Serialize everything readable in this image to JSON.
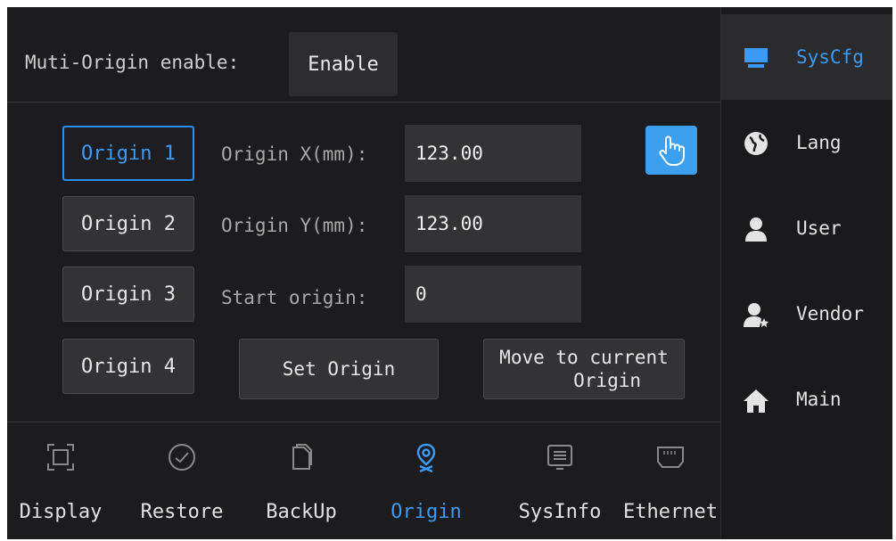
{
  "header": {
    "multi_origin_label": "Muti-Origin enable:",
    "enable_button": "Enable"
  },
  "origins": {
    "buttons": [
      "Origin 1",
      "Origin 2",
      "Origin 3",
      "Origin 4"
    ],
    "active_index": 0
  },
  "fields": {
    "x_label": "Origin X(mm):",
    "x_value": "123.00",
    "y_label": "Origin Y(mm):",
    "y_value": "123.00",
    "start_label": "Start origin:",
    "start_value": "0"
  },
  "actions": {
    "set_origin": "Set Origin",
    "move_to_current_line1": "Move to current",
    "move_to_current_line2": "Origin"
  },
  "tabs": [
    {
      "label": "Display",
      "icon": "display-icon"
    },
    {
      "label": "Restore",
      "icon": "clock-icon"
    },
    {
      "label": "BackUp",
      "icon": "copy-icon"
    },
    {
      "label": "Origin",
      "icon": "location-icon",
      "active": true
    },
    {
      "label": "SysInfo",
      "icon": "sysinfo-icon"
    },
    {
      "label": "Ethernet",
      "icon": "ethernet-icon"
    }
  ],
  "sidebar": {
    "items": [
      {
        "label": "SysCfg",
        "icon": "monitor-icon",
        "active": true
      },
      {
        "label": "Lang",
        "icon": "globe-icon"
      },
      {
        "label": "User",
        "icon": "user-icon"
      },
      {
        "label": "Vendor",
        "icon": "vendor-icon"
      },
      {
        "label": "Main",
        "icon": "home-icon"
      }
    ]
  },
  "colors": {
    "accent": "#3a9af5",
    "background": "#1c1c1e",
    "button": "#333335"
  }
}
